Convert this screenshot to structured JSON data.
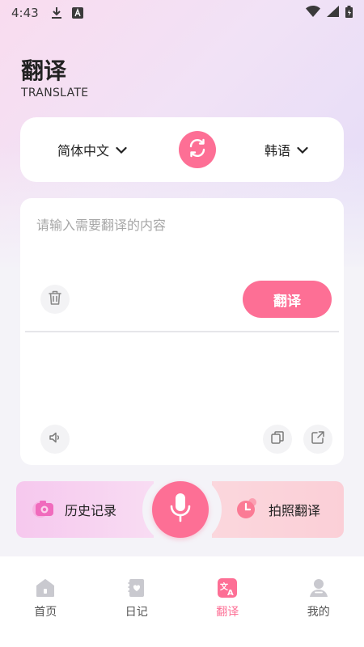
{
  "status_bar": {
    "time": "4:43",
    "icons": [
      "download-icon",
      "font-a-icon",
      "wifi-icon",
      "signal-icon",
      "battery-icon"
    ]
  },
  "header": {
    "title": "翻译",
    "subtitle": "TRANSLATE"
  },
  "language": {
    "source": "简体中文",
    "target": "韩语"
  },
  "translator": {
    "input_placeholder": "请输入需要翻译的内容",
    "input_value": "",
    "translate_label": "翻译",
    "output_text": ""
  },
  "actions": {
    "history_label": "历史记录",
    "photo_label": "拍照翻译"
  },
  "tabs": [
    {
      "label": "首页",
      "icon": "home-icon",
      "active": false
    },
    {
      "label": "日记",
      "icon": "diary-icon",
      "active": false
    },
    {
      "label": "翻译",
      "icon": "translate-icon",
      "active": true
    },
    {
      "label": "我的",
      "icon": "profile-icon",
      "active": false
    }
  ],
  "colors": {
    "accent": "#fd6f95",
    "bg_pink": "#f9dcef",
    "bg_lilac": "#e3dcf8"
  }
}
